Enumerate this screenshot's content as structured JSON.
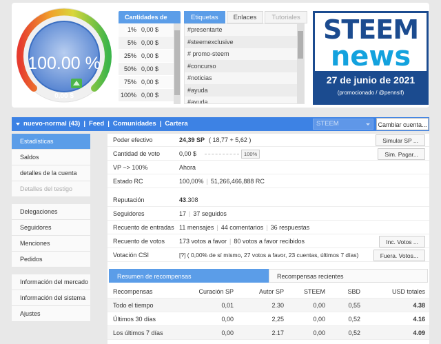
{
  "gauge": {
    "percent_label": "100.00 %",
    "value_label": "0,00 $",
    "level": 1.0
  },
  "vote_table": {
    "header": "Cantidades de voto",
    "rows": [
      {
        "pct": "1%",
        "val": "0,00 $"
      },
      {
        "pct": "5%",
        "val": "0,00 $"
      },
      {
        "pct": "25%",
        "val": "0,00 $"
      },
      {
        "pct": "50%",
        "val": "0,00 $"
      },
      {
        "pct": "75%",
        "val": "0,00 $"
      },
      {
        "pct": "100%",
        "val": "0,00 $"
      }
    ]
  },
  "tags": {
    "tabs": [
      "Etiquetas",
      "Enlaces",
      "Tutoriales"
    ],
    "items": [
      "#presentarte",
      "#steemexclusive",
      "# promo-steem",
      "#concurso",
      "#noticias",
      "#ayuda",
      "#ayuda"
    ]
  },
  "news": {
    "line1": "STEEM",
    "line2": "news",
    "date": "27 de junio de 2021",
    "promo": "(promocionado / @pennsif)"
  },
  "nav": {
    "account": "nuevo-normal (43)",
    "links": [
      "Feed",
      "Comunidades",
      "Cartera"
    ],
    "separator": "|",
    "select_value": "STEEM",
    "change_account": "Cambiar cuenta..."
  },
  "sidebar": {
    "group1": [
      "Estadísticas",
      "Saldos",
      "detalles de la cuenta",
      "Detalles del testigo"
    ],
    "group2": [
      "Delegaciones",
      "Seguidores",
      "Menciones",
      "Pedidos"
    ],
    "group3": [
      "Información del mercado",
      "Información del sistema",
      "Ajustes"
    ]
  },
  "stats": {
    "effective_power": {
      "label": "Poder efectivo",
      "value": "24,39 SP",
      "breakdown": "( 18,77 + 5,62 )",
      "button": "Simular SP ..."
    },
    "vote_amount": {
      "label": "Cantidad de voto",
      "value": "0,00 $",
      "slider": "100%",
      "slider_level": 1.0,
      "button": "Sim. Pagar..."
    },
    "vp": {
      "label": "VP ~> 100%",
      "value": "Ahora"
    },
    "rc": {
      "label": "Estado RC",
      "pct": "100,00%",
      "value": "51,266,466,888 RC"
    },
    "reputation": {
      "label": "Reputación",
      "value_bold": "43",
      "value_rest": ".308"
    },
    "followers": {
      "label": "Seguidores",
      "followers": "17",
      "following": "37 seguidos"
    },
    "posts": {
      "label": "Recuento de entradas",
      "a": "11 mensajes",
      "b": "44 comentarios",
      "c": "36 respuestas"
    },
    "votes": {
      "label": "Recuento de votos",
      "a": "173 votos a favor",
      "b": "80 votos a favor recibidos",
      "button": "Inc. Votos ..."
    },
    "csi": {
      "label": "Votación CSI",
      "value": "[?] ( 0,00% de sí mismo, 27 votos a favor, 23 cuentas, últimos 7 días)",
      "button": "Fuera. Votos..."
    }
  },
  "rewards": {
    "tabs": [
      "Resumen de recompensas",
      "Recompensas recientes"
    ],
    "columns": [
      "Recompensas",
      "Curación SP",
      "Autor SP",
      "STEEM",
      "SBD",
      "USD totales"
    ],
    "rows": [
      [
        "Todo el tiempo",
        "0,01",
        "2.30",
        "0,00",
        "0,55",
        "4.38"
      ],
      [
        "Últimos 30 días",
        "0,00",
        "2,25",
        "0,00",
        "0,52",
        "4.16"
      ],
      [
        "Los últimos 7 días",
        "0,00",
        "2.17",
        "0,00",
        "0,52",
        "4.09"
      ]
    ]
  },
  "colors": {
    "accent": "#3d82e4",
    "tab_active": "#5b9de8",
    "gauge_blue": "#5b8fd6",
    "news_blue": "#1b4b8f",
    "news_cyan": "#13a2de"
  }
}
